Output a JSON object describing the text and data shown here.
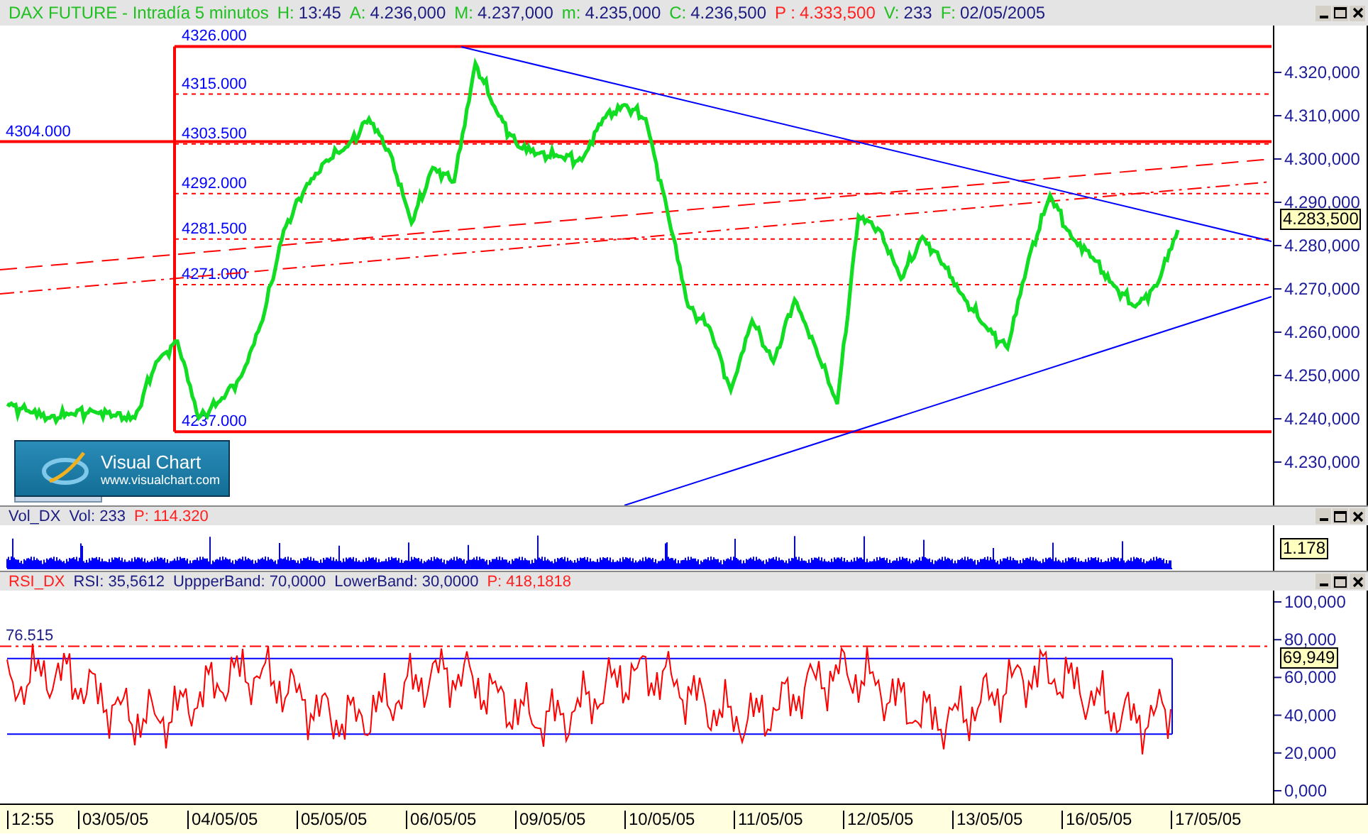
{
  "header": {
    "title": "DAX FUTURE - Intradía 5 minutos",
    "fields": [
      {
        "label": "H:",
        "value": "13:45",
        "kind": "normal"
      },
      {
        "label": "A:",
        "value": "4.236,000",
        "kind": "normal"
      },
      {
        "label": "M:",
        "value": "4.237,000",
        "kind": "normal"
      },
      {
        "label": "m:",
        "value": "4.235,000",
        "kind": "normal"
      },
      {
        "label": "C:",
        "value": "4.236,500",
        "kind": "normal"
      },
      {
        "label": "P :",
        "value": "4.333,500",
        "kind": "alert"
      },
      {
        "label": "V:",
        "value": "233",
        "kind": "normal"
      },
      {
        "label": "F:",
        "value": "02/05/2005",
        "kind": "normal"
      }
    ]
  },
  "price_panel": {
    "levels": [
      {
        "label": "4326.000",
        "kind": "solid"
      },
      {
        "label": "4315.000",
        "kind": "dashed"
      },
      {
        "label": "4304.000",
        "kind": "full"
      },
      {
        "label": "4303.500",
        "kind": "dashed"
      },
      {
        "label": "4292.000",
        "kind": "dashed"
      },
      {
        "label": "4281.500",
        "kind": "dashed"
      },
      {
        "label": "4271.000",
        "kind": "dashed"
      },
      {
        "label": "4237.000",
        "kind": "solid"
      }
    ],
    "axis_ticks": [
      "4.320,000",
      "4.310,000",
      "4.300,000",
      "4.290,000",
      "4.280,000",
      "4.270,000",
      "4.260,000",
      "4.250,000",
      "4.240,000",
      "4.230,000"
    ],
    "current_value": "4.283,500",
    "logo": {
      "name": "Visual Chart",
      "url": "www.visualchart.com"
    }
  },
  "volume_panel": {
    "title": "Vol_DX",
    "fields": [
      {
        "label": "Vol:",
        "value": "233",
        "kind": "normal"
      },
      {
        "label": "P:",
        "value": "114.320",
        "kind": "alert"
      }
    ],
    "current_value": "1.178"
  },
  "rsi_panel": {
    "title": "RSI_DX",
    "fields": [
      {
        "label": "RSI:",
        "value": "35,5612",
        "kind": "normal"
      },
      {
        "label": "UppperBand:",
        "value": "70,0000",
        "kind": "upper"
      },
      {
        "label": "LowerBand:",
        "value": "30,0000",
        "kind": "lower"
      },
      {
        "label": "P:",
        "value": "418,1818",
        "kind": "alert"
      }
    ],
    "level_label": "76.515",
    "axis_ticks": [
      "100,000",
      "80,000",
      "60,000",
      "40,000",
      "20,000",
      "0,000"
    ],
    "current_value": "69,949"
  },
  "date_axis": [
    "12:55",
    "03/05/05",
    "04/05/05",
    "05/05/05",
    "06/05/05",
    "09/05/05",
    "10/05/05",
    "11/05/05",
    "12/05/05",
    "13/05/05",
    "16/05/05",
    "17/05/05"
  ]
}
